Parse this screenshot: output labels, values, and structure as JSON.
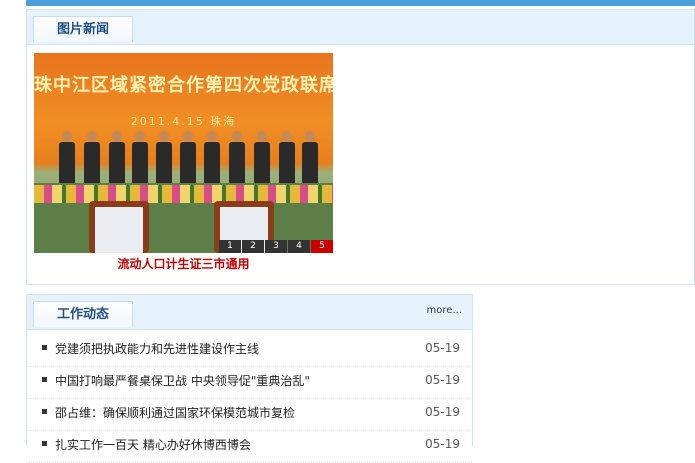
{
  "photo_news": {
    "tab_label": "图片新闻",
    "banner_text": "珠中江区域紧密合作第四次党政联席会",
    "banner_date": "2011.4.15 珠海",
    "caption": "流动人口计生证三市通用",
    "pager": [
      "1",
      "2",
      "3",
      "4",
      "5"
    ],
    "active_page": "5"
  },
  "work_news": {
    "tab_label": "工作动态",
    "more_label": "more...",
    "items": [
      {
        "title": "党建须把执政能力和先进性建设作主线",
        "date": "05-19"
      },
      {
        "title": "中国打响最严餐桌保卫战 中央领导促\"重典治乱\"",
        "date": "05-19"
      },
      {
        "title": "邵占维：确保顺利通过国家环保模范城市复检",
        "date": "05-19"
      },
      {
        "title": "扎实工作一百天 精心办好休博西博会",
        "date": "05-19"
      }
    ]
  },
  "colors": {
    "accent": "#4a9fd8",
    "caption": "#c00000",
    "pager_active": "#c90000"
  }
}
